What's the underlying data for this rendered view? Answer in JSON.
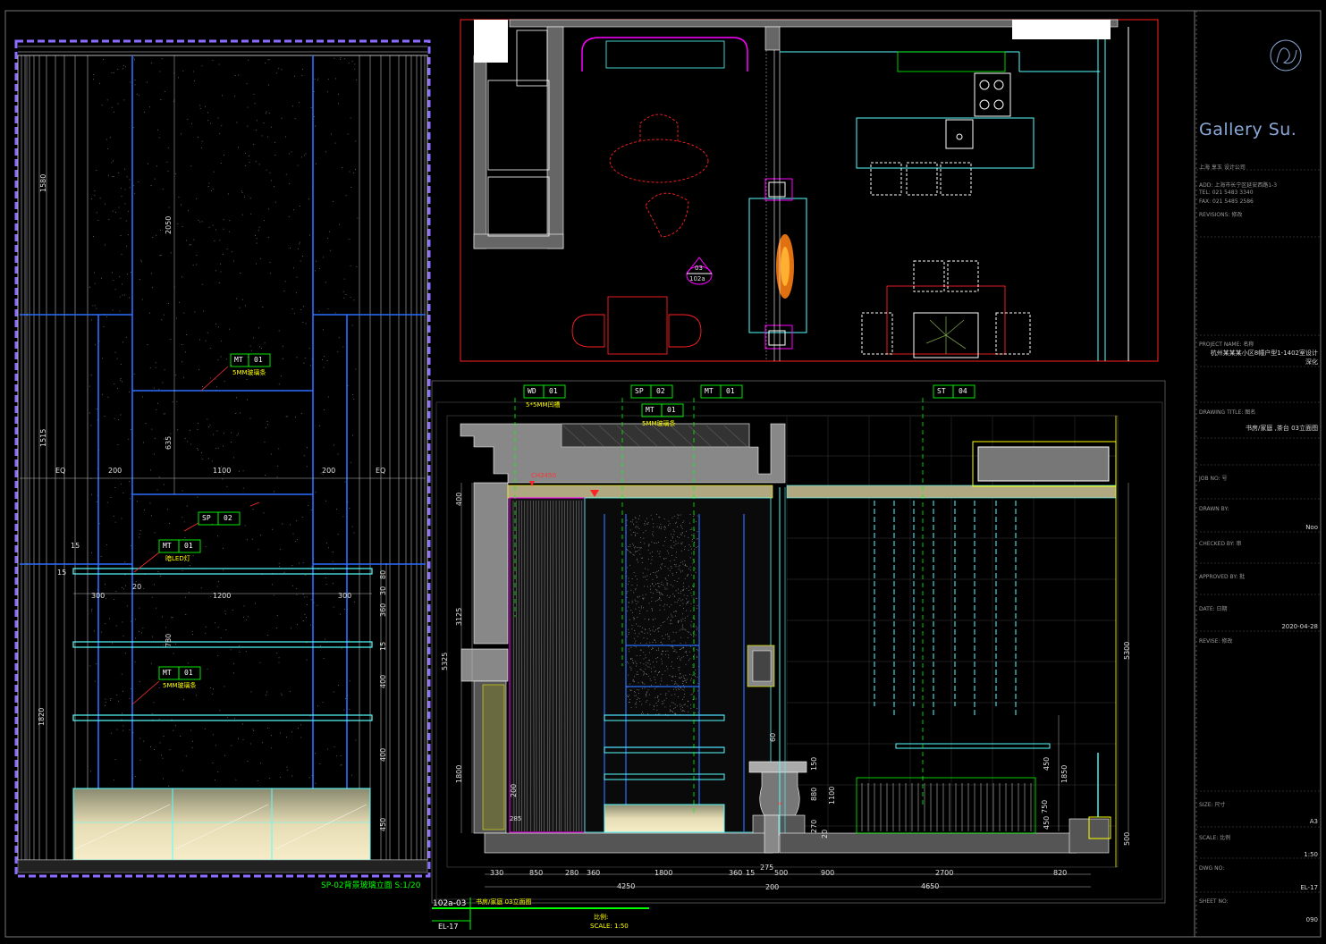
{
  "title_block": {
    "brand": "Gallery Su.",
    "company": "上海  享玉      设计公司",
    "address": "ADD: 上海市长宁区延安西路1-3",
    "tel": "TEL: 021 5483 3340",
    "fax": "FAX: 021 5485 2586",
    "revisions_label": "REVISIONS: 修改",
    "project_label": "PROJECT NAME: 名称",
    "project_value": "杭州某某某小区8幢户型1-1402室设计",
    "project_value2": "深化",
    "drawing_title_label": "DRAWING TITLE: 图名",
    "drawing_title_value": "书房/家庭 ,茶台 03立面图",
    "job_no_label": "JOB NO: 号",
    "drawn_by_label": "DRAWN BY:",
    "drawn_by_value": "Noo",
    "checked_by_label": "CHECKED BY: 审",
    "approved_by_label": "APPROVED BY: 批",
    "date_label": "DATE: 日期",
    "date_value": "2020-04-28",
    "revise_label": "REVISE: 修改",
    "size_label": "SIZE: 尺寸",
    "size_value": "A3",
    "scale_label": "SCALE: 比例",
    "scale_value": "1:50",
    "dwg_no_label": "DWG NO:",
    "dwg_no_value": "EL-17",
    "sheet_no_label": "SHEET NO:",
    "sheet_no_value": "090"
  },
  "left_panel": {
    "caption": "SP-02背景玻璃立面 S:1/20",
    "tags": [
      {
        "code": "MT",
        "num": "01",
        "note": "5MM玻璃条"
      },
      {
        "code": "SP",
        "num": "02",
        "note": ""
      },
      {
        "code": "MT",
        "num": "01",
        "note": "暗LED灯"
      },
      {
        "code": "MT",
        "num": "01",
        "note": "5MM玻璃条"
      }
    ],
    "dims": {
      "v1580": "1580",
      "v2050": "2050",
      "v1515": "1515",
      "v635": "635",
      "v1820": "1820",
      "h_eq1": "EQ",
      "h200a": "200",
      "h1100": "1100",
      "h200b": "200",
      "h_eq2": "EQ",
      "h300a": "300",
      "h1200": "1200",
      "h300b": "300",
      "v15a": "15",
      "v15b": "15",
      "v20": "20",
      "v80": "80",
      "v30": "30",
      "v360": "360",
      "v400a": "400",
      "v400b": "400",
      "v450": "450",
      "v780": "780",
      "v15c": "15"
    }
  },
  "elevation": {
    "tags": [
      {
        "code": "WD",
        "num": "01",
        "note": "5*5MM凹槽"
      },
      {
        "code": "SP",
        "num": "02",
        "note": ""
      },
      {
        "code": "MT",
        "num": "01",
        "note": "5MM玻璃条"
      },
      {
        "code": "MT",
        "num": "01",
        "note": ""
      },
      {
        "code": "ST",
        "num": "04",
        "note": ""
      }
    ],
    "ceiling_note": "CH2450",
    "dims_bottom": [
      "330",
      "850",
      "280",
      "360",
      "1800",
      "360",
      "15",
      "275",
      "500",
      "900",
      "2700",
      "820"
    ],
    "dims_total": [
      "4250",
      "200",
      "4650"
    ],
    "dims_left": [
      "400",
      "3125",
      "5325",
      "1800",
      "200"
    ],
    "dims_right": [
      "5300",
      "450",
      "1850",
      "750",
      "450",
      "500",
      "1100",
      "880",
      "150",
      "270",
      "20",
      "60"
    ],
    "footer_code": "102a-03",
    "footer_title": "书房/家庭 03立面图",
    "footer_drawing": "EL-17",
    "footer_ratio_label": "比例:",
    "footer_scale": "SCALE:   1:50",
    "footer_285": "285"
  },
  "plan": {
    "marker_top": "03",
    "marker_bottom": "102a"
  }
}
